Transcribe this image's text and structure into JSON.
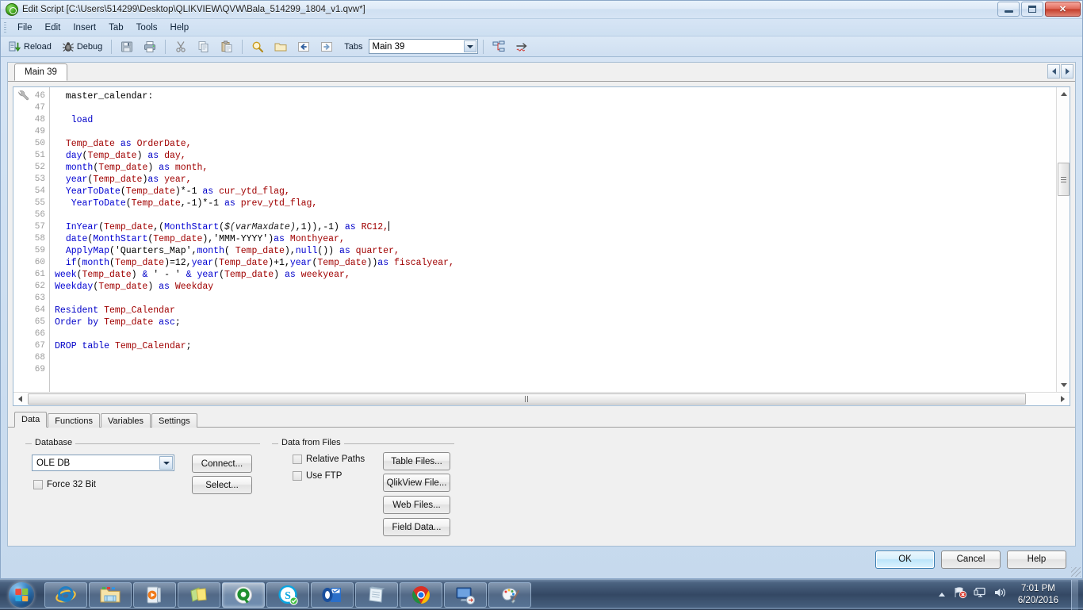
{
  "window": {
    "title": "Edit Script [C:\\Users\\514299\\Desktop\\QLIKVIEW\\QVW\\Bala_514299_1804_v1.qvw*]",
    "icon": "qlikview-icon",
    "minimize": "–",
    "maximize": "❐",
    "close": "✕"
  },
  "menu": {
    "items": [
      {
        "label": "File"
      },
      {
        "label": "Edit"
      },
      {
        "label": "Insert"
      },
      {
        "label": "Tab"
      },
      {
        "label": "Tools"
      },
      {
        "label": "Help"
      }
    ]
  },
  "toolbar": {
    "reload_label": "Reload",
    "debug_label": "Debug",
    "tabs_label": "Tabs",
    "tabs_value": "Main 39",
    "icons": [
      "save-icon",
      "print-icon",
      "cut-icon",
      "copy-icon",
      "paste-icon",
      "find-icon",
      "open-folder-icon",
      "back-icon",
      "forward-icon"
    ]
  },
  "script_tabs": {
    "tabs": [
      {
        "label": "Main 39",
        "active": true
      }
    ],
    "nav_prev": "◂",
    "nav_next": "▸"
  },
  "editor": {
    "first_line_number": 46,
    "lines": [
      {
        "n": 46,
        "tokens": [
          {
            "t": "  master_calendar:",
            "c": "plain"
          }
        ]
      },
      {
        "n": 47,
        "tokens": []
      },
      {
        "n": 48,
        "tokens": [
          {
            "t": "   ",
            "c": "plain"
          },
          {
            "t": "load",
            "c": "kw"
          }
        ]
      },
      {
        "n": 49,
        "tokens": []
      },
      {
        "n": 50,
        "tokens": [
          {
            "t": "  ",
            "c": "plain"
          },
          {
            "t": "Temp_date",
            "c": "id"
          },
          {
            "t": " ",
            "c": "plain"
          },
          {
            "t": "as",
            "c": "kw"
          },
          {
            "t": " ",
            "c": "plain"
          },
          {
            "t": "OrderDate,",
            "c": "id"
          }
        ]
      },
      {
        "n": 51,
        "tokens": [
          {
            "t": "  ",
            "c": "plain"
          },
          {
            "t": "day",
            "c": "fn"
          },
          {
            "t": "(",
            "c": "plain"
          },
          {
            "t": "Temp_date",
            "c": "id"
          },
          {
            "t": ") ",
            "c": "plain"
          },
          {
            "t": "as",
            "c": "kw"
          },
          {
            "t": " ",
            "c": "plain"
          },
          {
            "t": "day,",
            "c": "id"
          }
        ]
      },
      {
        "n": 52,
        "tokens": [
          {
            "t": "  ",
            "c": "plain"
          },
          {
            "t": "month",
            "c": "fn"
          },
          {
            "t": "(",
            "c": "plain"
          },
          {
            "t": "Temp_date",
            "c": "id"
          },
          {
            "t": ") ",
            "c": "plain"
          },
          {
            "t": "as",
            "c": "kw"
          },
          {
            "t": " ",
            "c": "plain"
          },
          {
            "t": "month,",
            "c": "id"
          }
        ]
      },
      {
        "n": 53,
        "tokens": [
          {
            "t": "  ",
            "c": "plain"
          },
          {
            "t": "year",
            "c": "fn"
          },
          {
            "t": "(",
            "c": "plain"
          },
          {
            "t": "Temp_date",
            "c": "id"
          },
          {
            "t": ")",
            "c": "plain"
          },
          {
            "t": "as",
            "c": "kw"
          },
          {
            "t": " ",
            "c": "plain"
          },
          {
            "t": "year,",
            "c": "id"
          }
        ]
      },
      {
        "n": 54,
        "tokens": [
          {
            "t": "  ",
            "c": "plain"
          },
          {
            "t": "YearToDate",
            "c": "fn"
          },
          {
            "t": "(",
            "c": "plain"
          },
          {
            "t": "Temp_date",
            "c": "id"
          },
          {
            "t": ")*-1 ",
            "c": "plain"
          },
          {
            "t": "as",
            "c": "kw"
          },
          {
            "t": " ",
            "c": "plain"
          },
          {
            "t": "cur_ytd_flag,",
            "c": "id"
          }
        ]
      },
      {
        "n": 55,
        "tokens": [
          {
            "t": "   ",
            "c": "plain"
          },
          {
            "t": "YearToDate",
            "c": "fn"
          },
          {
            "t": "(",
            "c": "plain"
          },
          {
            "t": "Temp_date",
            "c": "id"
          },
          {
            "t": ",-1)*-1 ",
            "c": "plain"
          },
          {
            "t": "as",
            "c": "kw"
          },
          {
            "t": " ",
            "c": "plain"
          },
          {
            "t": "prev_ytd_flag,",
            "c": "id"
          }
        ]
      },
      {
        "n": 56,
        "tokens": []
      },
      {
        "n": 57,
        "tokens": [
          {
            "t": "  ",
            "c": "plain"
          },
          {
            "t": "InYear",
            "c": "fn"
          },
          {
            "t": "(",
            "c": "plain"
          },
          {
            "t": "Temp_date",
            "c": "id"
          },
          {
            "t": ",(",
            "c": "plain"
          },
          {
            "t": "MonthStart",
            "c": "fn"
          },
          {
            "t": "(",
            "c": "plain"
          },
          {
            "t": "$(varMaxdate)",
            "c": "var"
          },
          {
            "t": ",1)),-1) ",
            "c": "plain"
          },
          {
            "t": "as",
            "c": "kw"
          },
          {
            "t": " ",
            "c": "plain"
          },
          {
            "t": "RC12,",
            "c": "id"
          }
        ],
        "caret": true
      },
      {
        "n": 58,
        "tokens": [
          {
            "t": "  ",
            "c": "plain"
          },
          {
            "t": "date",
            "c": "fn"
          },
          {
            "t": "(",
            "c": "plain"
          },
          {
            "t": "MonthStart",
            "c": "fn"
          },
          {
            "t": "(",
            "c": "plain"
          },
          {
            "t": "Temp_date",
            "c": "id"
          },
          {
            "t": "),",
            "c": "plain"
          },
          {
            "t": "'MMM-YYYY'",
            "c": "str"
          },
          {
            "t": ")",
            "c": "plain"
          },
          {
            "t": "as",
            "c": "kw"
          },
          {
            "t": " ",
            "c": "plain"
          },
          {
            "t": "Monthyear,",
            "c": "id"
          }
        ]
      },
      {
        "n": 59,
        "tokens": [
          {
            "t": "  ",
            "c": "plain"
          },
          {
            "t": "ApplyMap",
            "c": "fn"
          },
          {
            "t": "(",
            "c": "plain"
          },
          {
            "t": "'Quarters_Map'",
            "c": "str"
          },
          {
            "t": ",",
            "c": "plain"
          },
          {
            "t": "month",
            "c": "fn"
          },
          {
            "t": "( ",
            "c": "plain"
          },
          {
            "t": "Temp_date",
            "c": "id"
          },
          {
            "t": "),",
            "c": "plain"
          },
          {
            "t": "null",
            "c": "fn"
          },
          {
            "t": "()) ",
            "c": "plain"
          },
          {
            "t": "as",
            "c": "kw"
          },
          {
            "t": " ",
            "c": "plain"
          },
          {
            "t": "quarter,",
            "c": "id"
          }
        ]
      },
      {
        "n": 60,
        "tokens": [
          {
            "t": "  ",
            "c": "plain"
          },
          {
            "t": "if",
            "c": "kw"
          },
          {
            "t": "(",
            "c": "plain"
          },
          {
            "t": "month",
            "c": "fn"
          },
          {
            "t": "(",
            "c": "plain"
          },
          {
            "t": "Temp_date",
            "c": "id"
          },
          {
            "t": ")=12,",
            "c": "plain"
          },
          {
            "t": "year",
            "c": "fn"
          },
          {
            "t": "(",
            "c": "plain"
          },
          {
            "t": "Temp_date",
            "c": "id"
          },
          {
            "t": ")+1,",
            "c": "plain"
          },
          {
            "t": "year",
            "c": "fn"
          },
          {
            "t": "(",
            "c": "plain"
          },
          {
            "t": "Temp_date",
            "c": "id"
          },
          {
            "t": "))",
            "c": "plain"
          },
          {
            "t": "as",
            "c": "kw"
          },
          {
            "t": " ",
            "c": "plain"
          },
          {
            "t": "fiscalyear,",
            "c": "id"
          }
        ]
      },
      {
        "n": 61,
        "tokens": [
          {
            "t": "week",
            "c": "fn"
          },
          {
            "t": "(",
            "c": "plain"
          },
          {
            "t": "Temp_date",
            "c": "id"
          },
          {
            "t": ") ",
            "c": "plain"
          },
          {
            "t": "&",
            "c": "kw"
          },
          {
            "t": " ",
            "c": "plain"
          },
          {
            "t": "' - '",
            "c": "str"
          },
          {
            "t": " ",
            "c": "plain"
          },
          {
            "t": "&",
            "c": "kw"
          },
          {
            "t": " ",
            "c": "plain"
          },
          {
            "t": "year",
            "c": "fn"
          },
          {
            "t": "(",
            "c": "plain"
          },
          {
            "t": "Temp_date",
            "c": "id"
          },
          {
            "t": ") ",
            "c": "plain"
          },
          {
            "t": "as",
            "c": "kw"
          },
          {
            "t": " ",
            "c": "plain"
          },
          {
            "t": "weekyear,",
            "c": "id"
          }
        ]
      },
      {
        "n": 62,
        "tokens": [
          {
            "t": "Weekday",
            "c": "fn"
          },
          {
            "t": "(",
            "c": "plain"
          },
          {
            "t": "Temp_date",
            "c": "id"
          },
          {
            "t": ") ",
            "c": "plain"
          },
          {
            "t": "as",
            "c": "kw"
          },
          {
            "t": " ",
            "c": "plain"
          },
          {
            "t": "Weekday",
            "c": "id"
          }
        ]
      },
      {
        "n": 63,
        "tokens": []
      },
      {
        "n": 64,
        "tokens": [
          {
            "t": "Resident",
            "c": "kw"
          },
          {
            "t": " ",
            "c": "plain"
          },
          {
            "t": "Temp_Calendar",
            "c": "id"
          }
        ]
      },
      {
        "n": 65,
        "tokens": [
          {
            "t": "Order by",
            "c": "kw"
          },
          {
            "t": " ",
            "c": "plain"
          },
          {
            "t": "Temp_date",
            "c": "id"
          },
          {
            "t": " ",
            "c": "plain"
          },
          {
            "t": "asc",
            "c": "kw"
          },
          {
            "t": ";",
            "c": "plain"
          }
        ]
      },
      {
        "n": 66,
        "tokens": []
      },
      {
        "n": 67,
        "tokens": [
          {
            "t": "DROP",
            "c": "kw"
          },
          {
            "t": " ",
            "c": "plain"
          },
          {
            "t": "table",
            "c": "kw"
          },
          {
            "t": " ",
            "c": "plain"
          },
          {
            "t": "Temp_Calendar",
            "c": "id"
          },
          {
            "t": ";",
            "c": "plain"
          }
        ]
      },
      {
        "n": 68,
        "tokens": []
      },
      {
        "n": 69,
        "tokens": []
      }
    ]
  },
  "bottom_tabs": [
    {
      "label": "Data",
      "active": true
    },
    {
      "label": "Functions",
      "active": false
    },
    {
      "label": "Variables",
      "active": false
    },
    {
      "label": "Settings",
      "active": false
    }
  ],
  "database_group": {
    "title": "Database",
    "provider_value": "OLE DB",
    "connect_label": "Connect...",
    "select_label": "Select...",
    "force32_label": "Force 32 Bit",
    "force32_checked": false
  },
  "data_from_files_group": {
    "title": "Data from Files",
    "relative_paths_label": "Relative Paths",
    "relative_paths_checked": false,
    "use_ftp_label": "Use FTP",
    "use_ftp_checked": false,
    "buttons": [
      {
        "label": "Table Files..."
      },
      {
        "label": "QlikView File..."
      },
      {
        "label": "Web Files..."
      },
      {
        "label": "Field Data..."
      }
    ]
  },
  "dialog_buttons": {
    "ok": "OK",
    "cancel": "Cancel",
    "help": "Help"
  },
  "taskbar": {
    "start_label": "Start",
    "apps": [
      {
        "name": "internet-explorer",
        "active": false
      },
      {
        "name": "windows-explorer",
        "active": false
      },
      {
        "name": "windows-media-player",
        "active": false
      },
      {
        "name": "sticky-notes",
        "active": false
      },
      {
        "name": "qlikview",
        "active": true
      },
      {
        "name": "skype",
        "active": false
      },
      {
        "name": "outlook",
        "active": false
      },
      {
        "name": "notepad",
        "active": false
      },
      {
        "name": "google-chrome",
        "active": false
      },
      {
        "name": "remote-desktop",
        "active": false
      },
      {
        "name": "paint",
        "active": false
      }
    ],
    "tray_icons": [
      "network-error-icon",
      "display-icon",
      "volume-icon"
    ],
    "clock_time": "7:01 PM",
    "clock_date": "6/20/2016"
  }
}
